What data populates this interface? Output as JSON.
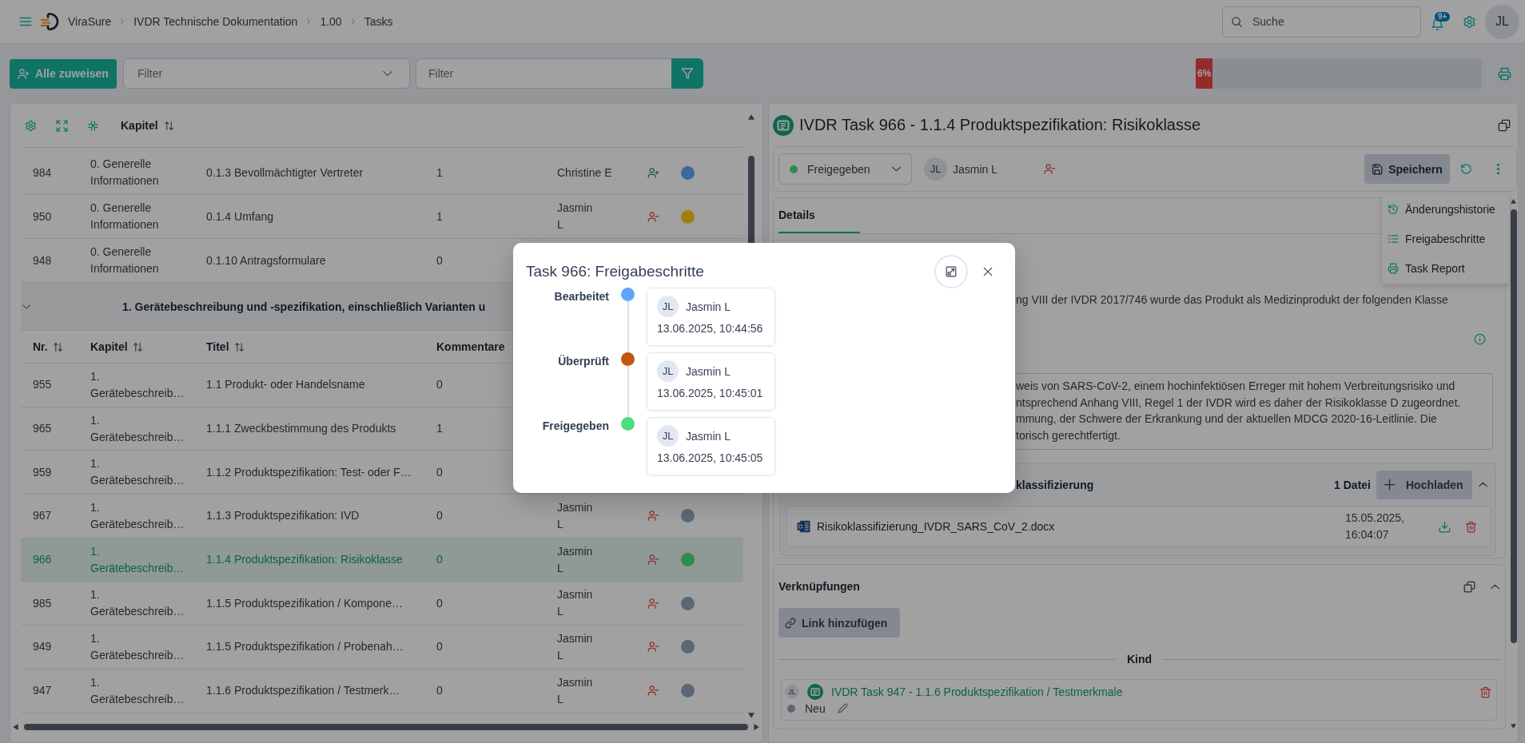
{
  "topbar": {
    "breadcrumbs": [
      {
        "label": "ViraSure"
      },
      {
        "label": "IVDR Technische Dokumentation"
      },
      {
        "label": "1.00"
      },
      {
        "label": "Tasks"
      }
    ],
    "search": {
      "placeholder": "Suche"
    },
    "notification_badge": "9+",
    "user_initials": "JL"
  },
  "toolbar": {
    "assign_button": "Alle zuweisen",
    "filter_select": {
      "placeholder": "Filter"
    },
    "filter_input": {
      "placeholder": "Filter"
    },
    "progress": {
      "label": "6%",
      "level": 0.06
    }
  },
  "task_list": {
    "sort_header": {
      "label": "Kapitel",
      "sortable": true
    },
    "leading_rows": [
      {
        "nr": "984",
        "chapter": "0. Generelle Informationen",
        "title": "0.1.3 Bevollmächtigter Vertreter",
        "comments": "1",
        "assignee": "Christine E",
        "kind": "add",
        "color": "#3c689e",
        "selected": false
      },
      {
        "nr": "950",
        "chapter": "0. Generelle Informationen",
        "title": "0.1.4 Umfang",
        "comments": "1",
        "assignee": "Jasmin L",
        "kind": "remove",
        "color": "#9e810d",
        "selected": false
      },
      {
        "nr": "948",
        "chapter": "0. Generelle Informationen",
        "title": "0.1.10 Antragsformulare",
        "comments": "0",
        "selected": false
      }
    ],
    "group": {
      "title": "1. Gerätebeschreibung und -spezifikation, einschließlich Varianten u",
      "expanded": true,
      "columns": [
        {
          "label": "Nr.",
          "sortable": true
        },
        {
          "label": "Kapitel",
          "sortable": true
        },
        {
          "label": "Titel",
          "sortable": true
        },
        {
          "label": "Kommentare",
          "sortable": false
        }
      ],
      "rows": [
        {
          "nr": "955",
          "chapter": "1. Gerätebeschreib…",
          "title": "1.1 Produkt- oder Handelsname",
          "comments": "0",
          "selected": false
        },
        {
          "nr": "965",
          "chapter": "1. Gerätebeschreib…",
          "title": "1.1.1 Zweckbestimmung des Produkts",
          "comments": "1",
          "selected": false
        },
        {
          "nr": "959",
          "chapter": "1. Gerätebeschreib…",
          "title": "1.1.2 Produktspezifikation: Test- oder F…",
          "comments": "0",
          "selected": false
        },
        {
          "nr": "967",
          "chapter": "1. Gerätebeschreib…",
          "title": "1.1.3 Produktspezifikation: IVD",
          "comments": "0",
          "assignee": "Jasmin L",
          "kind": "remove",
          "color": "#5d6774",
          "selected": false
        },
        {
          "nr": "966",
          "chapter": "1. Gerätebeschreib…",
          "title": "1.1.4 Produktspezifikation: Risikoklasse",
          "comments": "0",
          "assignee": "Jasmin L",
          "kind": "remove",
          "color": "#2f8c51",
          "selected": true
        },
        {
          "nr": "985",
          "chapter": "1. Gerätebeschreib…",
          "title": "1.1.5 Produktspezifikation / Kompone…",
          "comments": "0",
          "assignee": "Jasmin L",
          "kind": "remove",
          "color": "#5d6774",
          "selected": false
        },
        {
          "nr": "949",
          "chapter": "1. Gerätebeschreib…",
          "title": "1.1.5 Produktspezifikation / Probenah…",
          "comments": "0",
          "assignee": "Jasmin L",
          "kind": "remove",
          "color": "#5d6774",
          "selected": false
        },
        {
          "nr": "947",
          "chapter": "1. Gerätebeschreib…",
          "title": "1.1.6 Produktspezifikation / Testmerk…",
          "comments": "0",
          "assignee": "Jasmin L",
          "kind": "remove",
          "color": "#5d6774",
          "selected": false
        }
      ]
    }
  },
  "task": {
    "title": "IVDR Task 966 - 1.1.4 Produktspezifikation: Risikoklasse",
    "status": {
      "label": "Freigegeben",
      "color": "#2f8c51"
    },
    "assignee": {
      "initials": "JL",
      "name": "Jasmin L"
    },
    "save_button": "Speichern",
    "menu": [
      {
        "kind": "history",
        "label": "Änderungshistorie"
      },
      {
        "kind": "steps",
        "label": "Freigabeschritte"
      },
      {
        "kind": "print",
        "label": "Task Report"
      }
    ],
    "tabs": [
      {
        "label": "Details",
        "selected": true
      }
    ],
    "description": "ng VIII der IVDR 2017/746 wurde das Produkt als Medizinprodukt der folgenden Klasse",
    "justification_lines": [
      "weis von SARS-CoV-2, einem hochinfektiösen Erreger mit hohem Verbreitungsrisiko und",
      "ntsprechend Anhang VIII, Regel 1 der IVDR wird es daher der Risikoklasse D zugeordnet.",
      "mmung, der Schwere der Erkrankung und der aktuellen MDCG 2020-16-Leitlinie. Die",
      "torisch gerechtfertigt."
    ],
    "attachments": {
      "title": "klassifizierung",
      "count": "1 Datei",
      "upload_button": "Hochladen",
      "expanded": true,
      "files": [
        {
          "name": "Risikoklassifizierung_IVDR_SARS_CoV_2.docx",
          "date": "15.05.2025, 16:04:07"
        }
      ]
    },
    "links": {
      "title": "Verknüpfungen",
      "add_button": "Link hinzufügen",
      "expanded": true,
      "groups": [
        {
          "label": "Kind",
          "items": [
            {
              "initials": "JL",
              "title": "IVDR Task 947 - 1.1.6 Produktspezifikation / Testmerkmale",
              "status": "Neu",
              "color": "#5d6774"
            }
          ]
        }
      ]
    }
  },
  "modal": {
    "title": "Task 966: Freigabeschritte",
    "steps": [
      {
        "label": "Bearbeitet",
        "color": "#60a5fa",
        "initials": "JL",
        "user": "Jasmin L",
        "time": "13.06.2025, 10:44:56"
      },
      {
        "label": "Überprüft",
        "color": "#c2560e",
        "initials": "JL",
        "user": "Jasmin L",
        "time": "13.06.2025, 10:45:01"
      },
      {
        "label": "Freigegeben",
        "color": "#4ade80",
        "initials": "JL",
        "user": "Jasmin L",
        "time": "13.06.2025, 10:45:05"
      }
    ]
  }
}
